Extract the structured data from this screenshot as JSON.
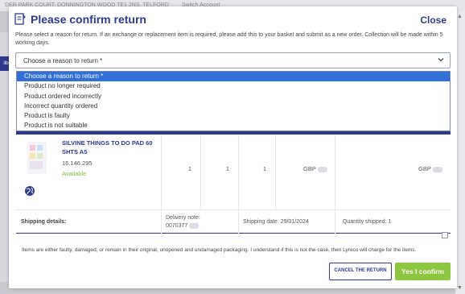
{
  "background": {
    "topbar": [
      "DER PARK COURT, DONNINGTON WOOD TE1 2NS, TELFORD",
      "Switch Account"
    ],
    "left_tab": "ilbe"
  },
  "modal": {
    "title": "Please confirm return",
    "close_label": "Close",
    "instructions": "Please select a reason for return. If an exchange or replacement item is required, please add this to your basket and submit as a new order. Collection will be made within 5 working days.",
    "reason_select": {
      "value": "Choose a reason to return *",
      "options": [
        "Choose a reason to return *",
        "Product no longer required",
        "Product ordered incorrectly",
        "Incorrect quantity ordered",
        "Product is faulty",
        "Product is not suitable"
      ],
      "selected_index": 0
    },
    "product": {
      "name": "SILVINE THINGS TO DO PAD 60 SHTS A5",
      "code": "16.146.295",
      "availability": "Available",
      "qty_1": "1",
      "qty_2": "1",
      "qty_3": "1",
      "price": "GBP",
      "total": "GBP"
    },
    "shipping": {
      "label": "Shipping details:",
      "delivery_note_label": "Delivery note:",
      "delivery_note_value": "0070377",
      "shipping_date": "Shipping date: 29/01/2024",
      "quantity_shipped": "Quantity shipped: 1"
    },
    "disclaimer": "Items are either faulty, damaged, or remain in their original, unopened and undamaged packaging. I understand if this is not the case, then Lyreco will charge for the items.",
    "cancel_label": "CANCEL THE RETURN",
    "confirm_label": "Yes I confirm"
  },
  "colors": {
    "brand": "#2e3a8c",
    "confirm": "#8dc63f",
    "available": "#7bbf3f",
    "selected_option": "#2f6fd6"
  }
}
